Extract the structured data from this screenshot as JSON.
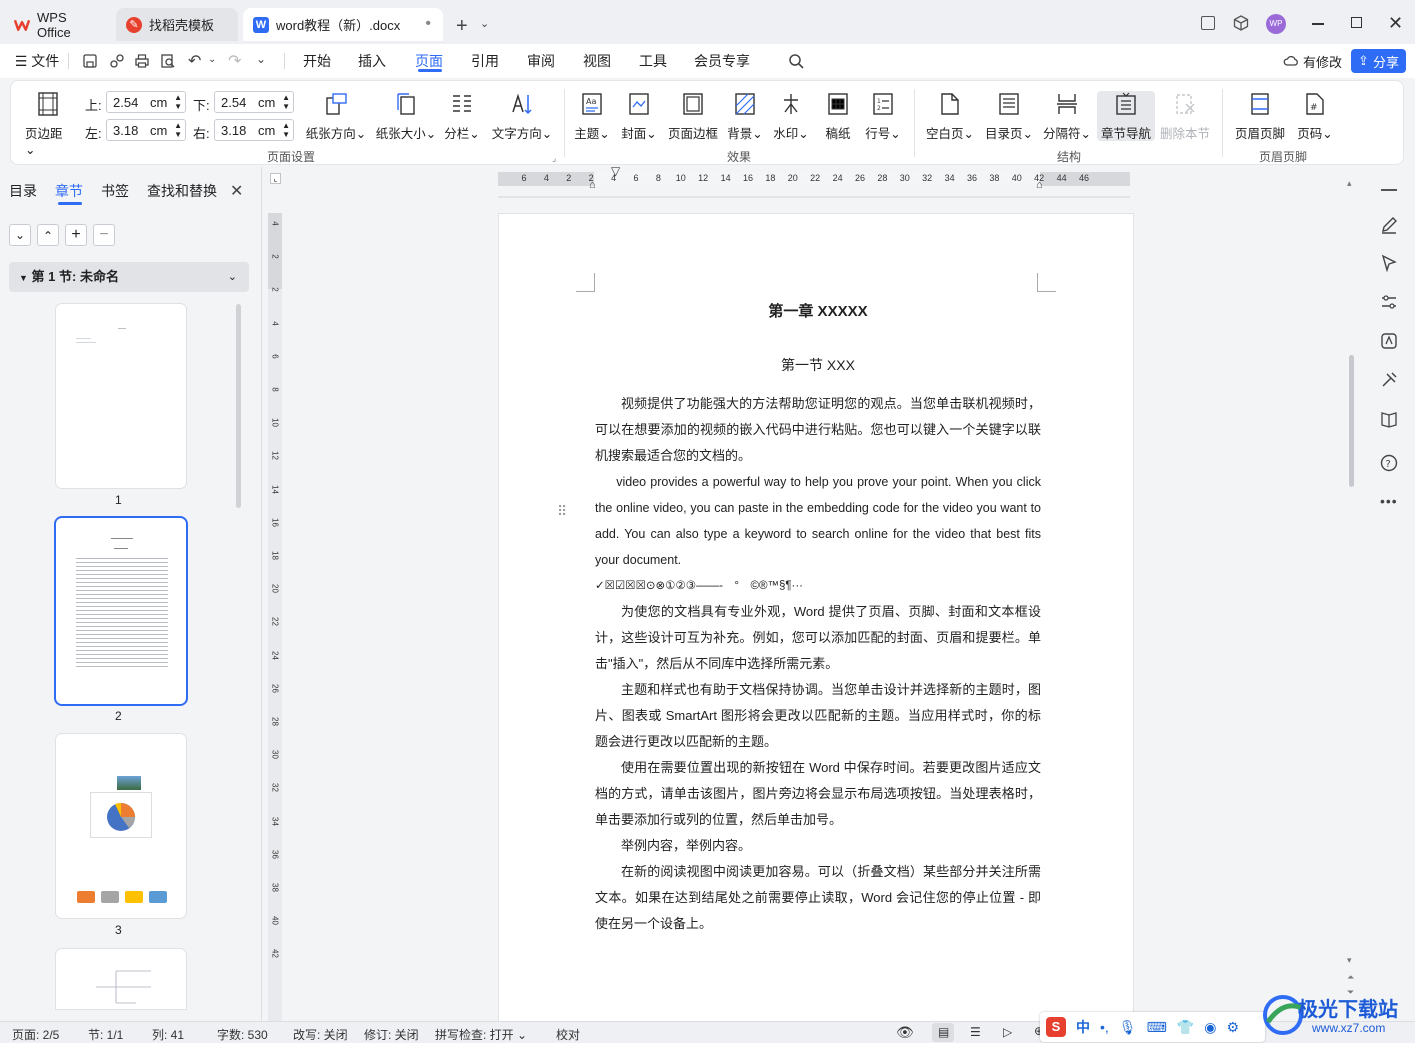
{
  "titlebar": {
    "tabs": [
      {
        "label": "WPS Office",
        "icon": "wps-logo-icon"
      },
      {
        "label": "找稻壳模板",
        "icon": "docer-icon"
      },
      {
        "label": "word教程（新）.docx",
        "icon": "word-doc-icon"
      }
    ],
    "avatar": "WP"
  },
  "menubar": {
    "file": "文件",
    "items": [
      "开始",
      "插入",
      "页面",
      "引用",
      "审阅",
      "视图",
      "工具",
      "会员专享"
    ],
    "active": "页面",
    "modified": "有修改",
    "share": "分享"
  },
  "ribbon": {
    "margins": {
      "label": "页边距",
      "top_label": "上:",
      "top": "2.54",
      "bottom_label": "下:",
      "bottom": "2.54",
      "left_label": "左:",
      "left": "3.18",
      "right_label": "右:",
      "right": "3.18",
      "unit": "cm"
    },
    "page_setup": [
      "纸张方向",
      "纸张大小",
      "分栏",
      "文字方向"
    ],
    "effects": [
      "主题",
      "封面",
      "页面边框",
      "背景",
      "水印",
      "稿纸",
      "行号"
    ],
    "structure": [
      "空白页",
      "目录页",
      "分隔符",
      "章节导航",
      "删除本节"
    ],
    "header_footer": [
      "页眉页脚",
      "页码"
    ],
    "groups": [
      "页面设置",
      "效果",
      "结构",
      "页眉页脚"
    ]
  },
  "navpane": {
    "tabs": [
      "目录",
      "章节",
      "书签",
      "查找和替换"
    ],
    "active_tab": "章节",
    "section_title": "第 1 节: 未命名",
    "pages": [
      "1",
      "2",
      "3"
    ]
  },
  "ruler": {
    "h_ticks": [
      "6",
      "4",
      "2",
      "2",
      "4",
      "6",
      "8",
      "10",
      "12",
      "14",
      "16",
      "18",
      "20",
      "22",
      "24",
      "26",
      "28",
      "30",
      "32",
      "34",
      "36",
      "38",
      "40",
      "42",
      "44",
      "46"
    ],
    "v_ticks": [
      "4",
      "2",
      "2",
      "4",
      "6",
      "8",
      "10",
      "12",
      "14",
      "16",
      "18",
      "20",
      "22",
      "24",
      "26",
      "28",
      "30",
      "32",
      "34",
      "36",
      "38",
      "40",
      "42"
    ]
  },
  "document": {
    "chapter": "第一章  XXXXX",
    "section": "第一节  XXX",
    "paragraphs": [
      "视频提供了功能强大的方法帮助您证明您的观点。当您单击联机视频时，可以在想要添加的视频的嵌入代码中进行粘贴。您也可以键入一个关键字以联机搜索最适合您的文档的。",
      "video provides a powerful way to help you prove your point. When you click the online video, you can paste in the embedding code for the video you want to add. You can also type a keyword to search online for the video that best fits your document.",
      "✓☒☑☒☒⊙⊗①②③——‐　°　©®™§¶···",
      "为使您的文档具有专业外观，Word 提供了页眉、页脚、封面和文本框设计，这些设计可互为补充。例如，您可以添加匹配的封面、页眉和提要栏。单击\"插入\"，然后从不同库中选择所需元素。",
      "主题和样式也有助于文档保持协调。当您单击设计并选择新的主题时，图片、图表或 SmartArt 图形将会更改以匹配新的主题。当应用样式时，你的标题会进行更改以匹配新的主题。",
      "使用在需要位置出现的新按钮在 Word 中保存时间。若要更改图片适应文档的方式，请单击该图片，图片旁边将会显示布局选项按钮。当处理表格时，单击要添加行或列的位置，然后单击加号。",
      "举例内容，举例内容。",
      "在新的阅读视图中阅读更加容易。可以（折叠文档）某些部分并关注所需文本。如果在达到结尾处之前需要停止读取，Word 会记住您的停止位置 - 即使在另一个设备上。"
    ]
  },
  "statusbar": {
    "page": "页面: 2/5",
    "section": "节: 1/1",
    "column": "列: 41",
    "wordcount": "字数: 530",
    "overtype": "改写: 关闭",
    "revision": "修订: 关闭",
    "spellcheck": "拼写检查: 打开",
    "proof": "校对",
    "ime": "中"
  },
  "watermark": {
    "text": "极光下载站",
    "url": "www.xz7.com"
  },
  "colors": {
    "accent": "#2f6cf6",
    "wps_red": "#e8402e"
  }
}
